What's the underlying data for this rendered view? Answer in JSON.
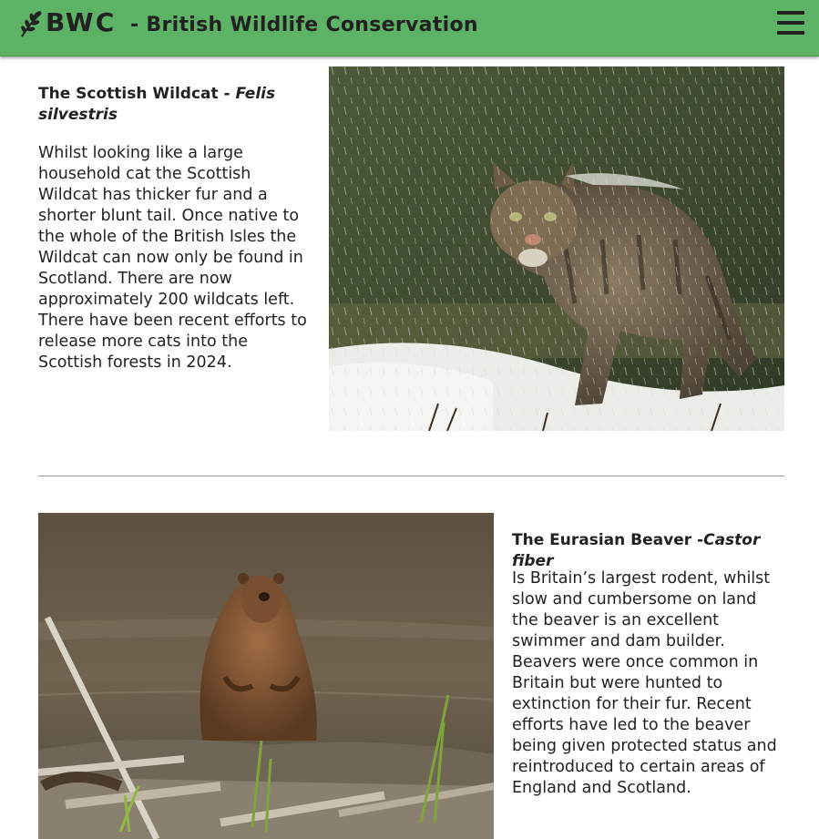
{
  "header": {
    "logo_text": "BWC",
    "logo_icon": "leaf-branch-icon",
    "title": "- British Wildlife Conservation",
    "menu_icon": "hamburger-menu-icon",
    "background_color": "#5cb265"
  },
  "animals": [
    {
      "common_name": "The Scottish Wildcat - ",
      "latin_name": "Felis silvestris",
      "description": "Whilst looking like a large household cat the Scottish Wildcat has thicker fur and a shorter blunt tail. Once native to the whole of the British Isles the Wildcat can now only be found in Scotland. There are now approximately 200 wildcats left. There have been recent efforts to release more cats into the Scottish forests in 2024."
    },
    {
      "common_name": "The Eurasian Beaver -",
      "latin_name": "Castor fiber",
      "description": "Is Britain’s largest rodent, whilst slow and cumbersome on land the beaver is an excellent swimmer and dam builder. Beavers were once common in Britain but were hunted to extinction for their fur. Recent efforts have led to the beaver being given protected status and reintroduced to certain areas of England and Scotland."
    }
  ]
}
